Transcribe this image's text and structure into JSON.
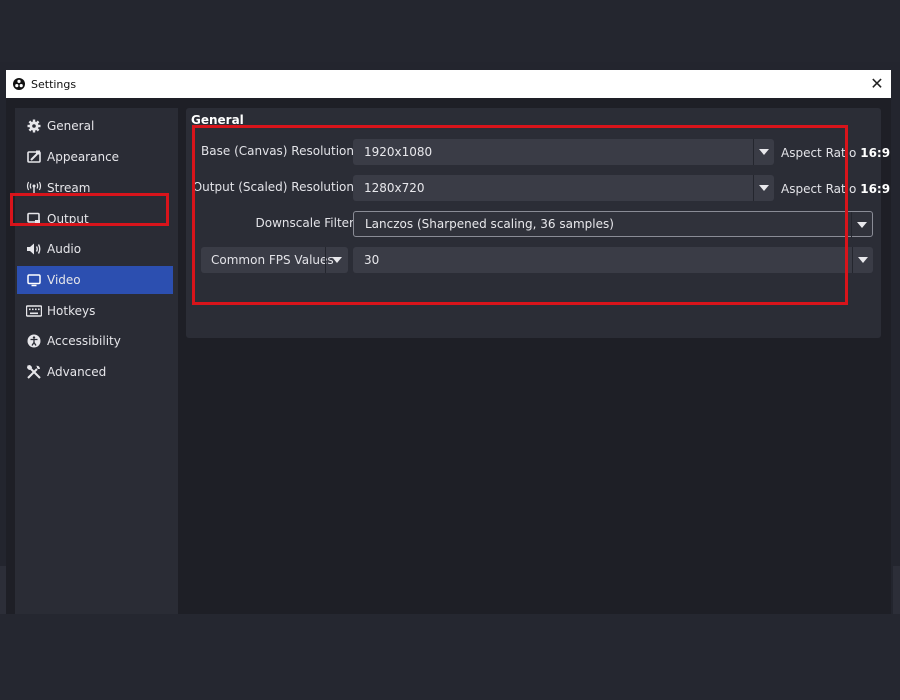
{
  "window": {
    "title": "Settings",
    "close_glyph": "✕"
  },
  "sidebar": {
    "items": [
      {
        "label": "General",
        "icon": "gear-icon",
        "active": false
      },
      {
        "label": "Appearance",
        "icon": "appearance-icon",
        "active": false
      },
      {
        "label": "Stream",
        "icon": "broadcast-icon",
        "active": false
      },
      {
        "label": "Output",
        "icon": "output-icon",
        "active": false
      },
      {
        "label": "Audio",
        "icon": "speaker-icon",
        "active": false
      },
      {
        "label": "Video",
        "icon": "monitor-icon",
        "active": true
      },
      {
        "label": "Hotkeys",
        "icon": "keyboard-icon",
        "active": false
      },
      {
        "label": "Accessibility",
        "icon": "accessibility-icon",
        "active": false
      },
      {
        "label": "Advanced",
        "icon": "tools-icon",
        "active": false
      }
    ]
  },
  "video": {
    "section_title": "General",
    "base_resolution": {
      "label": "Base (Canvas) Resolution",
      "value": "1920x1080",
      "aspect_prefix": "Aspect Ratio",
      "aspect_value": "16:9"
    },
    "output_resolution": {
      "label": "Output (Scaled) Resolution",
      "value": "1280x720",
      "aspect_prefix": "Aspect Ratio",
      "aspect_value": "16:9"
    },
    "downscale_filter": {
      "label": "Downscale Filter",
      "value": "Lanczos (Sharpened scaling, 36 samples)"
    },
    "fps": {
      "type_label": "Common FPS Values",
      "value": "30"
    }
  },
  "colors": {
    "highlight": "#d8141b",
    "active_item": "#2c4fb0",
    "background": "#1e1f26"
  }
}
